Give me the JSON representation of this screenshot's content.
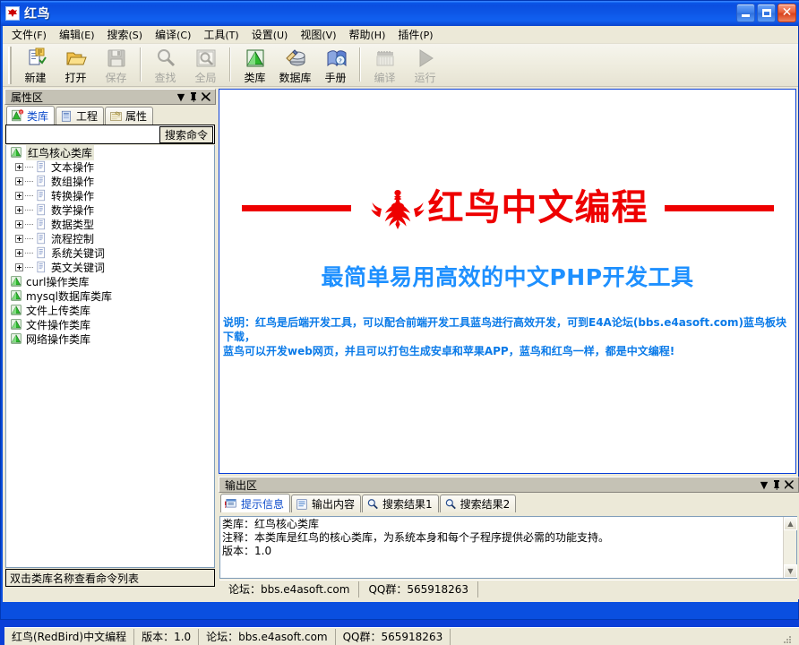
{
  "window": {
    "title": "红鸟",
    "app_icon": "red-bird-icon",
    "buttons": {
      "minimize": "_",
      "maximize": "□",
      "close": "✕"
    }
  },
  "menubar": {
    "items": [
      {
        "label": "文件",
        "mnemonic": "(F)"
      },
      {
        "label": "编辑",
        "mnemonic": "(E)"
      },
      {
        "label": "搜索",
        "mnemonic": "(S)"
      },
      {
        "label": "编译",
        "mnemonic": "(C)"
      },
      {
        "label": "工具",
        "mnemonic": "(T)"
      },
      {
        "label": "设置",
        "mnemonic": "(U)"
      },
      {
        "label": "视图",
        "mnemonic": "(V)"
      },
      {
        "label": "帮助",
        "mnemonic": "(H)"
      },
      {
        "label": "插件",
        "mnemonic": "(P)"
      }
    ]
  },
  "toolbar": {
    "buttons": [
      {
        "label": "新建",
        "icon": "new-file-icon",
        "enabled": true
      },
      {
        "label": "打开",
        "icon": "open-folder-icon",
        "enabled": true
      },
      {
        "label": "保存",
        "icon": "save-disk-icon",
        "enabled": false
      },
      {
        "label": "查找",
        "icon": "magnifier-icon",
        "enabled": false
      },
      {
        "label": "全局",
        "icon": "global-search-icon",
        "enabled": false
      },
      {
        "label": "类库",
        "icon": "library-icon",
        "enabled": true
      },
      {
        "label": "数据库",
        "icon": "database-icon",
        "enabled": true
      },
      {
        "label": "手册",
        "icon": "manual-book-icon",
        "enabled": true
      },
      {
        "label": "编译",
        "icon": "compile-icon",
        "enabled": false
      },
      {
        "label": "运行",
        "icon": "run-play-icon",
        "enabled": false
      }
    ]
  },
  "left_panel": {
    "caption": "属性区",
    "caption_buttons": [
      "dropdown-icon",
      "pin-icon",
      "close-icon"
    ],
    "tabs": [
      {
        "label": "类库",
        "icon": "library-tab-icon",
        "active": true
      },
      {
        "label": "工程",
        "icon": "project-tab-icon",
        "active": false
      },
      {
        "label": "属性",
        "icon": "properties-tab-icon",
        "active": false
      }
    ],
    "search": {
      "value": "",
      "placeholder": "",
      "button_label": "搜索命令"
    },
    "tree": [
      {
        "label": "红鸟核心类库",
        "icon": "library-icon",
        "level": 0,
        "expandable": false,
        "selected": true
      },
      {
        "label": "文本操作",
        "icon": "doc-icon",
        "level": 1,
        "expandable": true,
        "selected": false
      },
      {
        "label": "数组操作",
        "icon": "doc-icon",
        "level": 1,
        "expandable": true,
        "selected": false
      },
      {
        "label": "转换操作",
        "icon": "doc-icon",
        "level": 1,
        "expandable": true,
        "selected": false
      },
      {
        "label": "数学操作",
        "icon": "doc-icon",
        "level": 1,
        "expandable": true,
        "selected": false
      },
      {
        "label": "数据类型",
        "icon": "doc-icon",
        "level": 1,
        "expandable": true,
        "selected": false
      },
      {
        "label": "流程控制",
        "icon": "doc-icon",
        "level": 1,
        "expandable": true,
        "selected": false
      },
      {
        "label": "系统关键词",
        "icon": "doc-icon",
        "level": 1,
        "expandable": true,
        "selected": false
      },
      {
        "label": "英文关键词",
        "icon": "doc-icon",
        "level": 1,
        "expandable": true,
        "selected": false
      },
      {
        "label": "curl操作类库",
        "icon": "library-icon",
        "level": 0,
        "expandable": false,
        "selected": false
      },
      {
        "label": "mysql数据库类库",
        "icon": "library-icon",
        "level": 0,
        "expandable": false,
        "selected": false
      },
      {
        "label": "文件上传类库",
        "icon": "library-icon",
        "level": 0,
        "expandable": false,
        "selected": false
      },
      {
        "label": "文件操作类库",
        "icon": "library-icon",
        "level": 0,
        "expandable": false,
        "selected": false
      },
      {
        "label": "网络操作类库",
        "icon": "library-icon",
        "level": 0,
        "expandable": false,
        "selected": false
      }
    ],
    "hint": "双击类库名称查看命令列表"
  },
  "main": {
    "logo_text": "红鸟中文编程",
    "logo_icon": "phoenix-bird-icon",
    "slogan": "最简单易用高效的中文PHP开发工具",
    "description_line1": "说明：红鸟是后端开发工具，可以配合前端开发工具蓝鸟进行高效开发，可到E4A论坛(bbs.e4asoft.com)蓝鸟板块下载，",
    "description_line2": "蓝鸟可以开发web网页，并且可以打包生成安卓和苹果APP，蓝鸟和红鸟一样，都是中文编程!"
  },
  "output_panel": {
    "caption": "输出区",
    "caption_buttons": [
      "dropdown-icon",
      "pin-icon",
      "close-icon"
    ],
    "tabs": [
      {
        "label": "提示信息",
        "icon": "info-tab-icon",
        "active": true
      },
      {
        "label": "输出内容",
        "icon": "output-tab-icon",
        "active": false
      },
      {
        "label": "搜索结果1",
        "icon": "magnifier-icon",
        "active": false
      },
      {
        "label": "搜索结果2",
        "icon": "magnifier-icon",
        "active": false
      }
    ],
    "content": [
      "类库：红鸟核心类库",
      "注释：本类库是红鸟的核心类库，为系统本身和每个子程序提供必需的功能支持。",
      "版本：1.0"
    ],
    "status": [
      "论坛：bbs.e4asoft.com",
      "QQ群：565918263"
    ]
  },
  "statusbar": {
    "panels": [
      "红鸟(RedBird)中文编程",
      "版本：1.0",
      "论坛：bbs.e4asoft.com",
      "QQ群：565918263"
    ]
  },
  "colors": {
    "brand_red": "#ee0000",
    "slogan_blue": "#1e90ff",
    "desc_blue": "#0a7ae8",
    "title_blue": "#0b4ee0",
    "chrome": "#ece9d8"
  }
}
